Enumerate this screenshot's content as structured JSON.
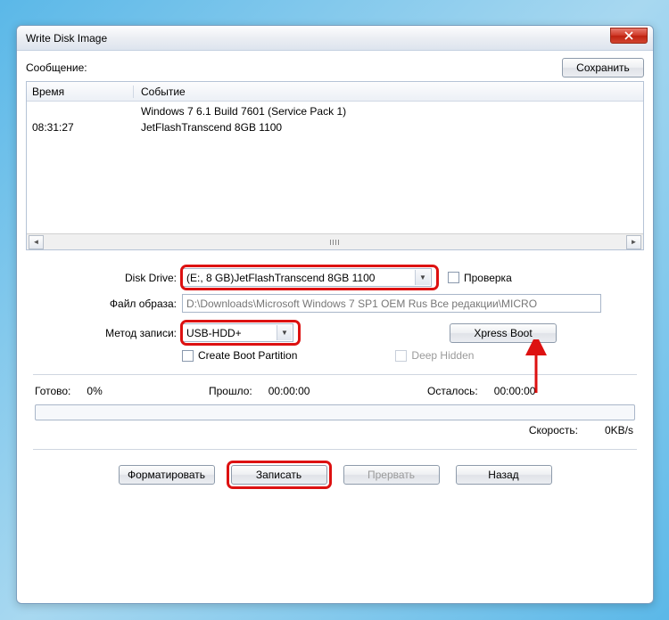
{
  "window": {
    "title": "Write Disk Image"
  },
  "message": {
    "label": "Сообщение:",
    "save": "Сохранить"
  },
  "log": {
    "col_time": "Время",
    "col_event": "Событие",
    "rows": [
      {
        "time": "",
        "event": "Windows 7 6.1 Build 7601 (Service Pack 1)"
      },
      {
        "time": "08:31:27",
        "event": "JetFlashTranscend 8GB   1100"
      }
    ]
  },
  "form": {
    "disk_drive": {
      "label": "Disk Drive:",
      "value": "(E:, 8 GB)JetFlashTranscend 8GB  1100"
    },
    "check": {
      "label": "Проверка"
    },
    "image_file": {
      "label": "Файл образа:",
      "value": "D:\\Downloads\\Microsoft Windows 7 SP1 OEM Rus Все редакции\\MICRO"
    },
    "write_method": {
      "label": "Метод записи:",
      "value": "USB-HDD+"
    },
    "xpress": "Xpress Boot",
    "create_boot": "Create Boot Partition",
    "deep_hidden": "Deep Hidden"
  },
  "status": {
    "ready": "Готово:",
    "ready_val": "0%",
    "elapsed": "Прошло:",
    "elapsed_val": "00:00:00",
    "remain": "Осталось:",
    "remain_val": "00:00:00",
    "speed": "Скорость:",
    "speed_val": "0KB/s"
  },
  "buttons": {
    "format": "Форматировать",
    "write": "Записать",
    "abort": "Прервать",
    "back": "Назад"
  }
}
